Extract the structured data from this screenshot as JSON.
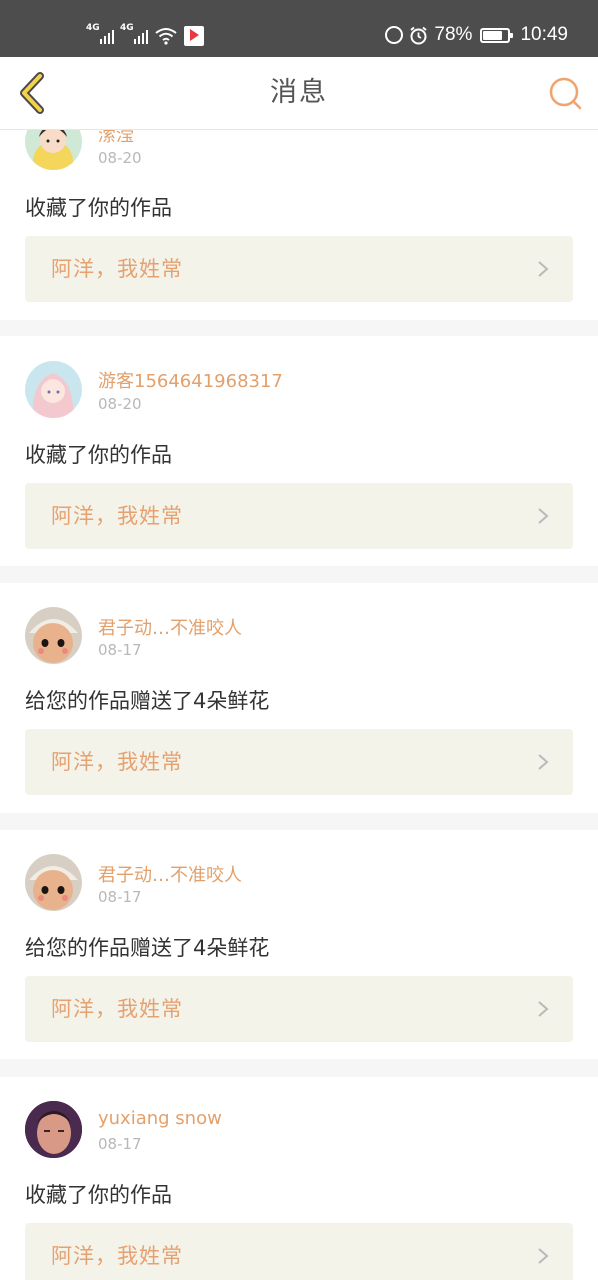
{
  "status_bar": {
    "signal_1_label": "4G",
    "signal_2_label": "4G",
    "icons": [
      "signal-icon",
      "signal-icon",
      "wifi-icon",
      "app-notification-icon",
      "nfc-icon",
      "alarm-icon",
      "battery-icon"
    ],
    "battery_level": 0.78,
    "battery_percent": "78%",
    "time": "10:49"
  },
  "nav": {
    "title": "消息",
    "back_icon": "chevron-left-icon",
    "search_icon": "search-icon",
    "accent_color": "#f0a36f",
    "back_color": "#f4d24c"
  },
  "messages": [
    {
      "name": "潆滢",
      "date": "08-20",
      "action": "收藏了你的作品",
      "work_title": "阿洋，我姓常"
    },
    {
      "name": "游客1564641968317",
      "date": "08-20",
      "action": "收藏了你的作品",
      "work_title": "阿洋，我姓常"
    },
    {
      "name": "君子动…不准咬人",
      "date": "08-17",
      "action": "给您的作品赠送了4朵鲜花",
      "work_title": "阿洋，我姓常"
    },
    {
      "name": "君子动…不准咬人",
      "date": "08-17",
      "action": "给您的作品赠送了4朵鲜花",
      "work_title": "阿洋，我姓常"
    },
    {
      "name": "yuxiang snow",
      "date": "08-17",
      "action": "收藏了你的作品",
      "work_title": "阿洋，我姓常"
    }
  ],
  "colors": {
    "username": "#e3a06b",
    "work_title": "#e6a170",
    "work_bg": "#f4f3ea",
    "date": "#b8b8b8",
    "separator": "#f6f6f6"
  }
}
